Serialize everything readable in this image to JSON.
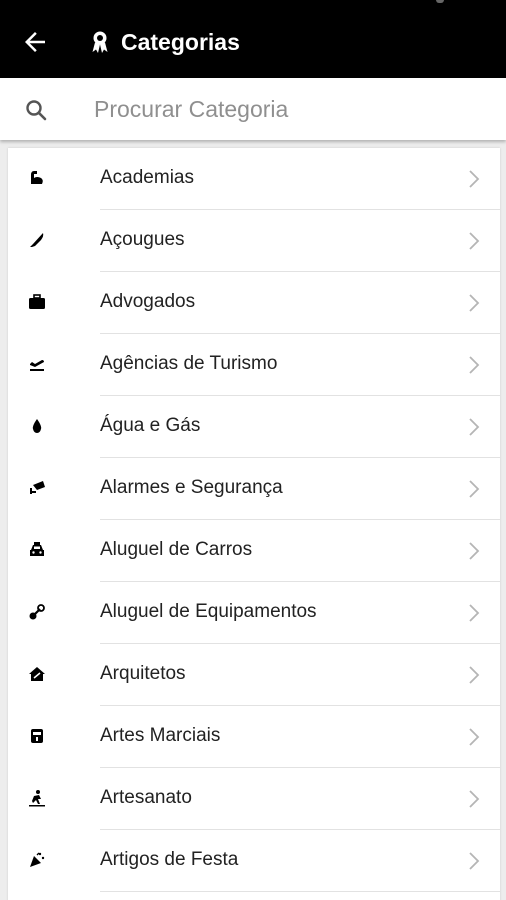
{
  "appbar": {
    "title": "Categorias",
    "back_icon": "arrow-back-icon",
    "title_icon": "ribbon-award-icon"
  },
  "search": {
    "placeholder": "Procurar Categoria",
    "icon": "search-icon"
  },
  "categories": [
    {
      "label": "Academias",
      "icon": "flexed-arm-icon"
    },
    {
      "label": "Açougues",
      "icon": "knife-icon"
    },
    {
      "label": "Advogados",
      "icon": "briefcase-icon"
    },
    {
      "label": "Agências de Turismo",
      "icon": "airplane-takeoff-icon"
    },
    {
      "label": "Água e Gás",
      "icon": "water-drop-icon"
    },
    {
      "label": "Alarmes e Segurança",
      "icon": "security-camera-icon"
    },
    {
      "label": "Aluguel de Carros",
      "icon": "car-icon"
    },
    {
      "label": "Aluguel de Equipamentos",
      "icon": "tools-icon"
    },
    {
      "label": "Arquitetos",
      "icon": "house-icon"
    },
    {
      "label": "Artes Marciais",
      "icon": "belt-icon"
    },
    {
      "label": "Artesanato",
      "icon": "craft-person-icon"
    },
    {
      "label": "Artigos de Festa",
      "icon": "party-popper-icon"
    }
  ],
  "colors": {
    "appbar": "#000000",
    "background": "#ededed",
    "card": "#ffffff",
    "text": "#222222",
    "placeholder": "#8f8f8f",
    "chevron": "#b5b5b5",
    "divider": "#e2e2e2"
  }
}
